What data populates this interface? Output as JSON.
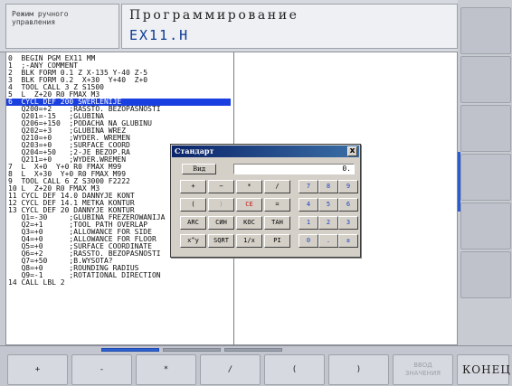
{
  "header": {
    "mode_label": "Режим ручного\nуправления",
    "title": "Программирование",
    "filename": "EX11.H"
  },
  "program": {
    "lines": [
      "0  BEGIN PGM EX11 MM",
      "1  ;-ANY COMMENT",
      "2  BLK FORM 0.1 Z X-135 Y-40 Z-5",
      "3  BLK FORM 0.2  X+30  Y+40  Z+0",
      "4  TOOL CALL 3 Z S1500",
      "5  L  Z+20 R0 FMAX M3",
      "6  CYCL DEF 200 SWERLENIJE",
      "   Q200=+2    ;RASSTO. BEZOPASNOSTI",
      "   Q201=-15   ;GLUBINA",
      "   Q206=+150  ;PODACHA NA GLUBINU",
      "   Q202=+3    ;GLUBINA WREZ",
      "   Q210=+0    ;WYDER. WREMEN",
      "   Q203=+0    ;SURFACE COORD",
      "   Q204=+50   ;2-JE BEZOP.RA",
      "   Q211=+0    ;WYDER.WREMEN",
      "7  L  X+0  Y+0 R0 FMAX M99",
      "8  L  X+30  Y+0 R0 FMAX M99",
      "9  TOOL CALL 6 Z S3000 F2222",
      "10 L  Z+20 R0 FMAX M3",
      "11 CYCL DEF 14.0 DANNYJE KONT",
      "12 CYCL DEF 14.1 METKA KONTUR",
      "13 CYCL DEF 20 DANNYJE KONTUR",
      "   Q1=-30     ;GLUBINA FREZEROWANIJA",
      "   Q2=+1      ;TOOL PATH OVERLAP",
      "   Q3=+0      ;ALLOWANCE FOR SIDE",
      "   Q4=+0      ;ALLOWANCE FOR FLOOR",
      "   Q5=+0      ;SURFACE COORDINATE",
      "   Q6=+2      ;RASSTO. BEZOPASNOSTI",
      "   Q7=+50     ;B.WYSOTA?",
      "   Q8=+0      ;ROUNDING RADIUS",
      "   Q9=-1      ;ROTATIONAL DIRECTION",
      "14 CALL LBL 2"
    ],
    "active_line_index": 6
  },
  "calculator": {
    "title": "Стандарт",
    "close_label": "x",
    "view_label": "Вид",
    "display_value": "0.",
    "rows": [
      [
        "+",
        "−",
        "*",
        "/",
        "7",
        "8",
        "9"
      ],
      [
        "(",
        ")",
        "CE",
        "=",
        "4",
        "5",
        "6"
      ],
      [
        "ARC",
        "СИН",
        "КОС",
        "ТАН",
        "1",
        "2",
        "3"
      ],
      [
        "x^y",
        "SQRT",
        "1/x",
        "PI",
        "0",
        ".",
        "±"
      ]
    ]
  },
  "softkeys": {
    "labels": [
      "+",
      "-",
      "*",
      "/",
      "(",
      ")",
      "ВВОД\nЗНАЧЕНИЯ",
      "КОНЕЦ"
    ]
  },
  "colors": {
    "active_line": "#1a3fe0",
    "number_key_text": "#1c3fbf",
    "ce_key_text": "#c21b1b",
    "title_bar": "#0a246a"
  }
}
